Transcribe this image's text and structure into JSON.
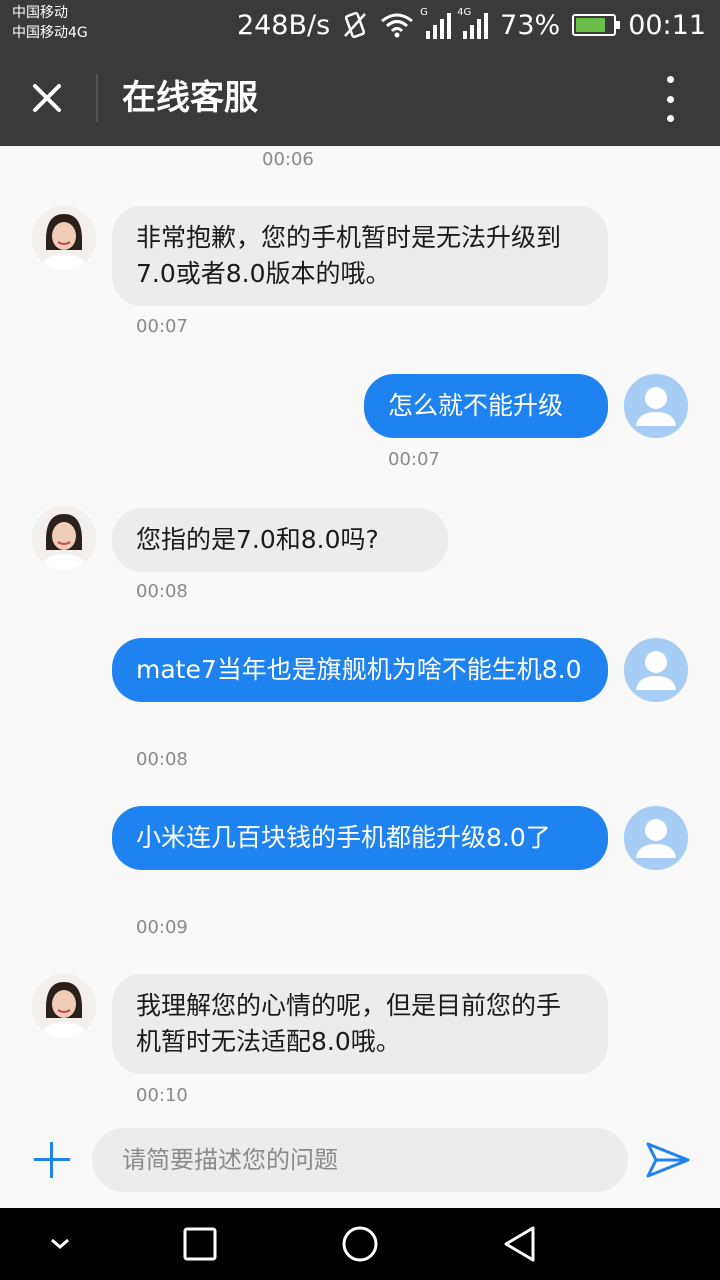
{
  "status_bar": {
    "carrier1": "中国移动",
    "carrier2": "中国移动4G",
    "speed": "248B/s",
    "sim1_tag": "G",
    "sim2_tag": "4G",
    "battery": "73%",
    "time": "00:11",
    "battery_level": 0.73,
    "battery_color": "#6cc04a"
  },
  "header": {
    "title": "在线客服",
    "close_icon": "close-icon",
    "more_icon": "more-vertical-icon"
  },
  "messages": [
    {
      "sender": "agent",
      "text": "非常抱歉，您的手机暂时是无法升级到7.0或者8.0版本的哦。",
      "time": "00:07"
    },
    {
      "sender": "user",
      "text": "怎么就不能升级",
      "time": "00:07"
    },
    {
      "sender": "agent",
      "text": "您指的是7.0和8.0吗?",
      "time": "00:08"
    },
    {
      "sender": "user",
      "text": "mate7当年也是旗舰机为啥不能生机8.0",
      "time": "00:08"
    },
    {
      "sender": "user",
      "text": "小米连几百块钱的手机都能升级8.0了",
      "time": "00:09"
    },
    {
      "sender": "agent",
      "text": "我理解您的心情的呢，但是目前您的手机暂时无法适配8.0哦。",
      "time": "00:10"
    }
  ],
  "top_timestamp": "00:06",
  "input": {
    "placeholder": "请简要描述您的问题",
    "value": ""
  },
  "colors": {
    "accent": "#1e83f0",
    "header_bg": "#3a3a3a",
    "agent_bubble": "#ececec",
    "user_bubble": "#1e83f0"
  }
}
